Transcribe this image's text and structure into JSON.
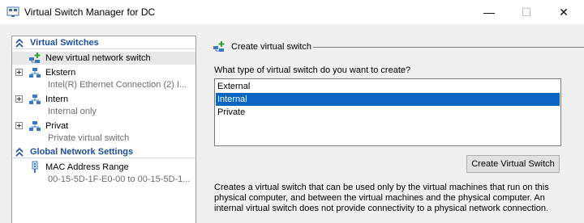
{
  "window": {
    "title": "Virtual Switch Manager for DC",
    "minimize_glyph": "—",
    "maximize_glyph": "☐",
    "close_glyph": "✕"
  },
  "tree": {
    "virtual_switches_header": "Virtual Switches",
    "global_settings_header": "Global Network Settings",
    "items": [
      {
        "label": "New virtual network switch",
        "icon": "add-switch-icon",
        "selected": true
      },
      {
        "label": "Ekstern",
        "sub": "Intel(R) Ethernet Connection (2) I...",
        "icon": "network-switch-icon"
      },
      {
        "label": "Intern",
        "sub": "Internal only",
        "icon": "network-switch-icon"
      },
      {
        "label": "Privat",
        "sub": "Private virtual switch",
        "icon": "network-switch-icon"
      }
    ],
    "mac": {
      "label": "MAC Address Range",
      "sub": "00-15-5D-1F-E0-00 to 00-15-5D-1...",
      "icon": "mac-address-icon"
    }
  },
  "panel": {
    "header": "Create virtual switch",
    "question": "What type of virtual switch do you want to create?",
    "options": [
      "External",
      "Internal",
      "Private"
    ],
    "selected_option": "Internal",
    "create_button": "Create Virtual Switch",
    "description_lines": [
      "Creates a virtual switch that can be used only by the virtual machines that run on this",
      "physical computer, and between the virtual machines and the physical computer. An",
      "internal virtual switch does not provide connectivity to a physical network connection."
    ]
  },
  "colors": {
    "accent": "#1f4e9d",
    "selection": "#0a66c2"
  }
}
